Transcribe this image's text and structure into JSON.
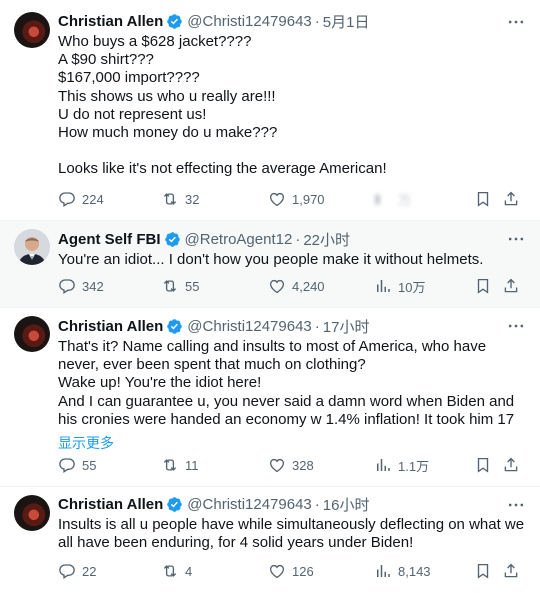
{
  "tweets": [
    {
      "name": "Christian Allen",
      "handle": "@Christi12479643",
      "dot": "·",
      "time": "5月1日",
      "body": "Who buys a $628 jacket????\nA $90 shirt???\n$167,000 import????\nThis shows us who u really are!!!\nU do not represent us!\nHow much money do u make???\n\nLooks like it's not effecting the average American!",
      "replies": "224",
      "retweets": "32",
      "likes": "1,970",
      "views": "万"
    },
    {
      "name": "Agent Self FBI",
      "handle": "@RetroAgent12",
      "dot": "·",
      "time": "22小时",
      "body": "You're an idiot... I don't how you people make it without helmets.",
      "replies": "342",
      "retweets": "55",
      "likes": "4,240",
      "views": "10万"
    },
    {
      "name": "Christian Allen",
      "handle": "@Christi12479643",
      "dot": "·",
      "time": "17小时",
      "body": "That's it? Name calling and insults to most of America, who have never, ever been spent that much on clothing?\nWake up! You're the idiot here!\nAnd I can guarantee u, you never said a damn word when Biden and his cronies were handed an economy w 1.4% inflation! It took him 17",
      "show_more": "显示更多",
      "replies": "55",
      "retweets": "11",
      "likes": "328",
      "views": "1.1万"
    },
    {
      "name": "Christian Allen",
      "handle": "@Christi12479643",
      "dot": "·",
      "time": "16小时",
      "body": "Insults is all u people have while simultaneously deflecting on what we all have been enduring, for 4 solid years under Biden!",
      "replies": "22",
      "retweets": "4",
      "likes": "126",
      "views": "8,143"
    }
  ],
  "colors": {
    "accent": "#1d9bf0",
    "muted": "#536471",
    "text": "#0f1419",
    "alt_bg": "#f7f9f9"
  },
  "icons": [
    "verified-badge-icon",
    "more-icon",
    "reply-icon",
    "retweet-icon",
    "like-icon",
    "views-icon",
    "bookmark-icon",
    "share-icon"
  ]
}
